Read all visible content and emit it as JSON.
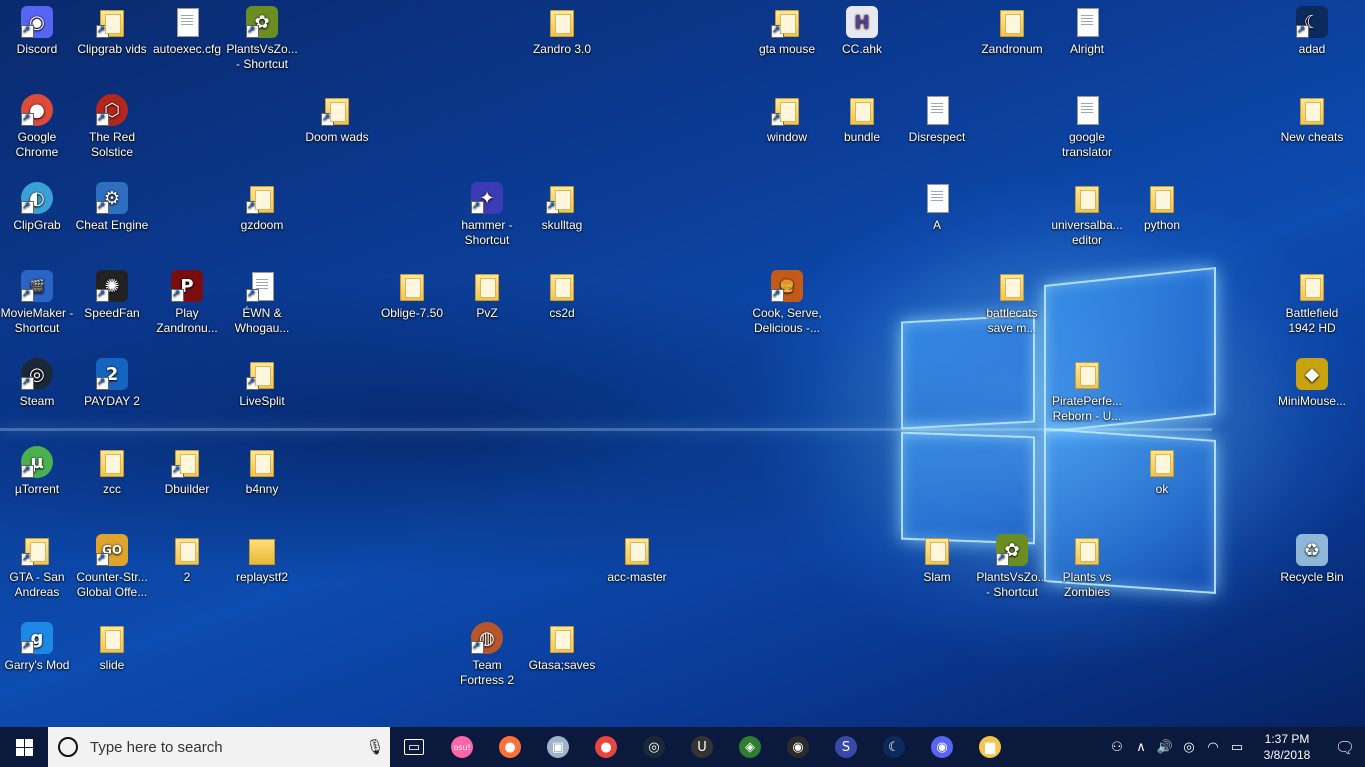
{
  "desktop": {
    "icons": [
      {
        "id": "discord",
        "label": "Discord",
        "type": "app",
        "color": "#5865f2",
        "glyph": "◉",
        "shortcut": true
      },
      {
        "id": "clipgrab-vids",
        "label": "Clipgrab vids",
        "type": "folder",
        "shortcut": true
      },
      {
        "id": "autoexec",
        "label": "autoexec.cfg",
        "type": "doc",
        "shortcut": false
      },
      {
        "id": "pvz-shortcut-1",
        "label": "PlantsVsZo... - Shortcut",
        "type": "app",
        "color": "#6b8e23",
        "glyph": "✿",
        "shortcut": true
      },
      {
        "id": "zandro",
        "label": "Zandro 3.0",
        "type": "folder",
        "shortcut": false
      },
      {
        "id": "gta-mouse",
        "label": "gta mouse",
        "type": "folder",
        "shortcut": true
      },
      {
        "id": "cc-ahk",
        "label": "CC.ahk",
        "type": "app",
        "color": "#e8e8f2",
        "glyph": "H",
        "glyphColor": "#5a3d8a",
        "shortcut": false
      },
      {
        "id": "zandronum",
        "label": "Zandronum",
        "type": "folder",
        "shortcut": false
      },
      {
        "id": "alright",
        "label": "Alright",
        "type": "doc",
        "shortcut": false
      },
      {
        "id": "adad",
        "label": "adad",
        "type": "app",
        "color": "#0d2a5c",
        "glyph": "☾",
        "shortcut": true
      },
      {
        "id": "chrome",
        "label": "Google Chrome",
        "type": "circle",
        "color": "#dd4b39",
        "glyph": "●",
        "shortcut": true
      },
      {
        "id": "red-solstice",
        "label": "The Red Solstice",
        "type": "circle",
        "color": "#b3261e",
        "glyph": "⬡",
        "shortcut": true
      },
      {
        "id": "doom-wads",
        "label": "Doom wads",
        "type": "folder",
        "shortcut": true
      },
      {
        "id": "window",
        "label": "window",
        "type": "folder",
        "shortcut": true
      },
      {
        "id": "bundle",
        "label": "bundle",
        "type": "folder",
        "shortcut": false
      },
      {
        "id": "disrespect",
        "label": "Disrespect",
        "type": "doc",
        "shortcut": false
      },
      {
        "id": "google-translator",
        "label": "google translator",
        "type": "doc",
        "shortcut": false
      },
      {
        "id": "new-cheats",
        "label": "New cheats",
        "type": "folder",
        "shortcut": false
      },
      {
        "id": "clipgrab",
        "label": "ClipGrab",
        "type": "circle",
        "color": "#3aa0d8",
        "glyph": "◐",
        "shortcut": true
      },
      {
        "id": "cheat-engine",
        "label": "Cheat Engine",
        "type": "app",
        "color": "#2f6fbf",
        "glyph": "⚙",
        "shortcut": true
      },
      {
        "id": "gzdoom",
        "label": "gzdoom",
        "type": "folder",
        "shortcut": true
      },
      {
        "id": "hammer",
        "label": "hammer - Shortcut",
        "type": "app",
        "color": "#3b3bb5",
        "glyph": "✦",
        "shortcut": true
      },
      {
        "id": "skulltag",
        "label": "skulltag",
        "type": "folder",
        "shortcut": true
      },
      {
        "id": "a-doc",
        "label": "A",
        "type": "doc",
        "shortcut": false
      },
      {
        "id": "universalba",
        "label": "universalba... editor",
        "type": "folder",
        "shortcut": false
      },
      {
        "id": "python",
        "label": "python",
        "type": "folder",
        "shortcut": false
      },
      {
        "id": "moviemaker",
        "label": "MovieMaker - Shortcut",
        "type": "app",
        "color": "#2b64c4",
        "glyph": "🎬",
        "shortcut": true
      },
      {
        "id": "speedfan",
        "label": "SpeedFan",
        "type": "app",
        "color": "#222",
        "glyph": "✺",
        "shortcut": true
      },
      {
        "id": "play-zandronum",
        "label": "Play Zandronu...",
        "type": "app",
        "color": "#7a0d0d",
        "glyph": "P",
        "shortcut": true
      },
      {
        "id": "ewn",
        "label": "ÉWN & Whogau...",
        "type": "doc",
        "shortcut": true
      },
      {
        "id": "oblige",
        "label": "Oblige-7.50",
        "type": "folder",
        "shortcut": false
      },
      {
        "id": "pvz-folder",
        "label": "PvZ",
        "type": "folder",
        "shortcut": false
      },
      {
        "id": "cs2d",
        "label": "cs2d",
        "type": "folder",
        "shortcut": false
      },
      {
        "id": "cook-serve",
        "label": "Cook, Serve, Delicious -...",
        "type": "app",
        "color": "#c45a1a",
        "glyph": "🍔",
        "shortcut": true
      },
      {
        "id": "battlecats",
        "label": "battlecats save m...",
        "type": "folder",
        "shortcut": false
      },
      {
        "id": "battlefield",
        "label": "Battlefield 1942 HD",
        "type": "folder",
        "shortcut": false
      },
      {
        "id": "steam",
        "label": "Steam",
        "type": "circle",
        "color": "#1b2838",
        "glyph": "◎",
        "shortcut": true
      },
      {
        "id": "payday2",
        "label": "PAYDAY 2",
        "type": "app",
        "color": "#1565c0",
        "glyph": "2",
        "shortcut": true
      },
      {
        "id": "livesplit",
        "label": "LiveSplit",
        "type": "folder",
        "shortcut": true
      },
      {
        "id": "pirateperfection",
        "label": "PiratePerfe... Reborn - U...",
        "type": "folder",
        "shortcut": false
      },
      {
        "id": "minimouse",
        "label": "MiniMouse...",
        "type": "app",
        "color": "#c9a20f",
        "glyph": "◆",
        "shortcut": false
      },
      {
        "id": "utorrent",
        "label": "µTorrent",
        "type": "circle",
        "color": "#4caf50",
        "glyph": "µ",
        "shortcut": true
      },
      {
        "id": "zcc",
        "label": "zcc",
        "type": "folder",
        "shortcut": false
      },
      {
        "id": "dbuilder",
        "label": "Dbuilder",
        "type": "folder",
        "shortcut": true
      },
      {
        "id": "b4nny",
        "label": "b4nny",
        "type": "folder",
        "shortcut": false
      },
      {
        "id": "ok",
        "label": "ok",
        "type": "folder",
        "shortcut": false
      },
      {
        "id": "gta-sa",
        "label": "GTA - San Andreas",
        "type": "folder",
        "shortcut": true
      },
      {
        "id": "csgo",
        "label": "Counter-Str... Global Offe...",
        "type": "app",
        "color": "#e0a32e",
        "glyph": "GO",
        "shortcut": true
      },
      {
        "id": "two",
        "label": "2",
        "type": "folder",
        "shortcut": false
      },
      {
        "id": "replaystf2",
        "label": "replaystf2",
        "type": "folder-plain",
        "shortcut": false
      },
      {
        "id": "acc-master",
        "label": "acc-master",
        "type": "folder",
        "shortcut": false
      },
      {
        "id": "slam",
        "label": "Slam",
        "type": "folder",
        "shortcut": false
      },
      {
        "id": "pvz-shortcut-2",
        "label": "PlantsVsZo... - Shortcut",
        "type": "app",
        "color": "#6b8e23",
        "glyph": "✿",
        "shortcut": true
      },
      {
        "id": "plants-vs-zombies",
        "label": "Plants vs Zombies",
        "type": "folder",
        "shortcut": false
      },
      {
        "id": "recycle-bin",
        "label": "Recycle Bin",
        "type": "app",
        "color": "#8fb8d8",
        "glyph": "♻",
        "shortcut": false
      },
      {
        "id": "garrys-mod",
        "label": "Garry's Mod",
        "type": "app",
        "color": "#1e88e5",
        "glyph": "g",
        "shortcut": true
      },
      {
        "id": "slide",
        "label": "slide",
        "type": "folder",
        "shortcut": false
      },
      {
        "id": "tf2",
        "label": "Team Fortress 2",
        "type": "circle",
        "color": "#b8562b",
        "glyph": "◍",
        "shortcut": true
      },
      {
        "id": "gtasa-saves",
        "label": "Gtasa;saves",
        "type": "folder",
        "shortcut": false
      }
    ]
  },
  "taskbar": {
    "search_placeholder": "Type here to search",
    "apps": [
      {
        "id": "task-view",
        "glyph": "▭",
        "color": "#0b1a3c"
      },
      {
        "id": "osu",
        "glyph": "osu!",
        "color": "#ff66aa"
      },
      {
        "id": "firefox",
        "glyph": "●",
        "color": "#ff7139"
      },
      {
        "id": "monitor",
        "glyph": "▣",
        "color": "#9fb4c8"
      },
      {
        "id": "chrome",
        "glyph": "●",
        "color": "#e8453c"
      },
      {
        "id": "steam",
        "glyph": "◎",
        "color": "#1b2838"
      },
      {
        "id": "ultra",
        "glyph": "U",
        "color": "#333"
      },
      {
        "id": "paint",
        "glyph": "◈",
        "color": "#2e7d32"
      },
      {
        "id": "obs",
        "glyph": "◉",
        "color": "#2b2b2b"
      },
      {
        "id": "sonic",
        "glyph": "S",
        "color": "#3949ab"
      },
      {
        "id": "cheat",
        "glyph": "☾",
        "color": "#0d2a5c"
      },
      {
        "id": "discord",
        "glyph": "◉",
        "color": "#5865f2"
      },
      {
        "id": "explorer",
        "glyph": "▆",
        "color": "#f4c44b"
      }
    ],
    "clock_time": "1:37 PM",
    "clock_date": "3/8/2018"
  }
}
